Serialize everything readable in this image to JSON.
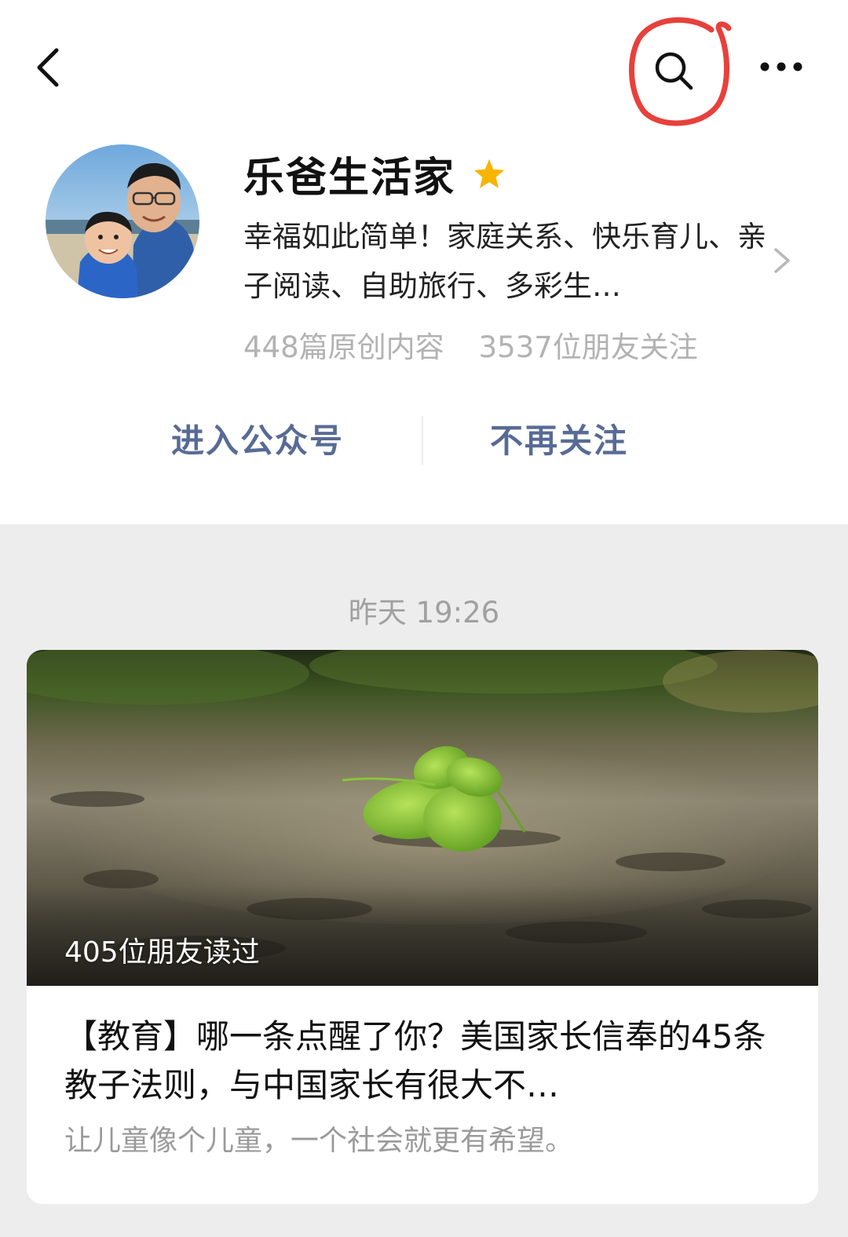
{
  "nav": {
    "back_icon": "chevron-left-icon",
    "search_icon": "search-icon",
    "more_icon": "more-dots-icon",
    "highlight_color": "#e8403b"
  },
  "profile": {
    "name": "乐爸生活家",
    "badge_icon": "star-icon",
    "badge_color": "#f7b500",
    "description": "幸福如此简单！家庭关系、快乐育儿、亲子阅读、自助旅行、多彩生…",
    "stats": {
      "original_articles": "448篇原创内容",
      "followers": "3537位朋友关注"
    }
  },
  "actions": {
    "enter_account": "进入公众号",
    "unfollow": "不再关注",
    "link_color": "#576b95"
  },
  "feed": {
    "timestamp": "昨天 19:26",
    "article": {
      "read_count": "405位朋友读过",
      "title": "【教育】哪一条点醒了你？美国家长信奉的45条教子法则，与中国家长有很大不…",
      "digest": "让儿童像个儿童，一个社会就更有希望。"
    }
  }
}
